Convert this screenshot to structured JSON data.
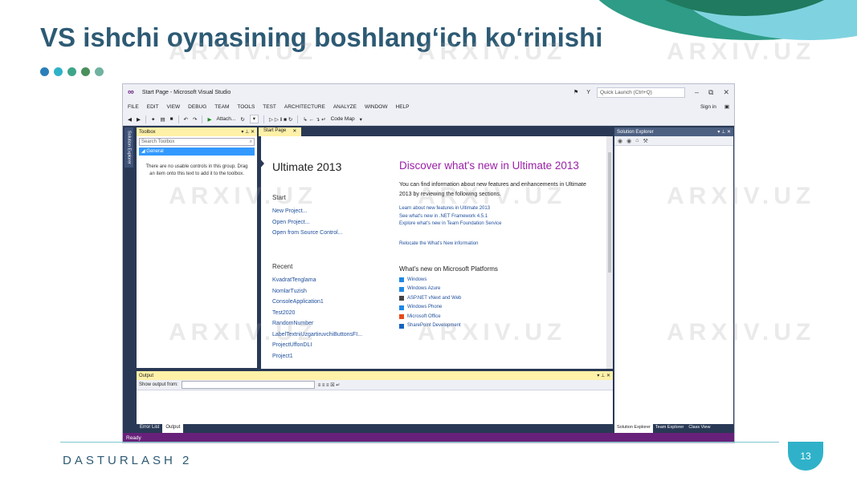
{
  "slide": {
    "title": "VS ishchi oynasining boshlang‘ich ko‘rinishi",
    "footer": "DASTURLASH 2",
    "page_number": "13",
    "dot_colors": [
      "#2a7fb8",
      "#2fb2c9",
      "#3fa58a",
      "#4a8f5c",
      "#6fb2a0"
    ],
    "watermark": "ARXIV.UZ"
  },
  "vs": {
    "title": "Start Page - Microsoft Visual Studio",
    "quick_launch": "Quick Launch (Ctrl+Q)",
    "sign_in": "Sign in",
    "menu": [
      "FILE",
      "EDIT",
      "VIEW",
      "DEBUG",
      "TEAM",
      "TOOLS",
      "TEST",
      "ARCHITECTURE",
      "ANALYZE",
      "WINDOW",
      "HELP"
    ],
    "toolbar": {
      "attach": "Attach...",
      "code_map": "Code Map"
    },
    "side_tab": "Solution Explorer",
    "toolbox": {
      "title": "Toolbox",
      "search_placeholder": "Search Toolbox",
      "group": "General",
      "message": "There are no usable controls in this group. Drag an item onto this text to add it to the toolbox."
    },
    "start_page": {
      "tab": "Start Page",
      "product": "Ultimate 2013",
      "start_heading": "Start",
      "start_links": [
        "New Project...",
        "Open Project...",
        "Open from Source Control..."
      ],
      "recent_heading": "Recent",
      "recent_links": [
        "KvadratTenglama",
        "NomlarTuzish",
        "ConsoleApplication1",
        "Test2020",
        "RandomNumber",
        "LabelTextniUzgartiruvchiButtonsFI...",
        "ProjectUffonDLI",
        "Project1"
      ],
      "discover_title": "Discover what's new in Ultimate 2013",
      "discover_desc": "You can find information about new features and enhancements in Ultimate 2013 by reviewing the following sections.",
      "learn_links": [
        "Learn about new features in Ultimate 2013",
        "See what's new in .NET Framework 4.5.1",
        "Explore what's new in Team Foundation Service"
      ],
      "relocate": "Relocate the What's New information",
      "platforms_heading": "What's new on Microsoft Platforms",
      "platforms": [
        {
          "name": "Windows",
          "color": "#1e88e5"
        },
        {
          "name": "Windows Azure",
          "color": "#1e88e5"
        },
        {
          "name": "ASP.NET vNext and Web",
          "color": "#444444"
        },
        {
          "name": "Windows Phone",
          "color": "#1e88e5"
        },
        {
          "name": "Microsoft Office",
          "color": "#e64a19"
        },
        {
          "name": "SharePoint Development",
          "color": "#1565c0"
        }
      ]
    },
    "output": {
      "title": "Output",
      "show_label": "Show output from:",
      "tabs": [
        "Error List",
        "Output"
      ]
    },
    "solution": {
      "title": "Solution Explorer",
      "tabs": [
        "Solution Explorer",
        "Team Explorer",
        "Class View"
      ]
    },
    "status": "Ready"
  }
}
